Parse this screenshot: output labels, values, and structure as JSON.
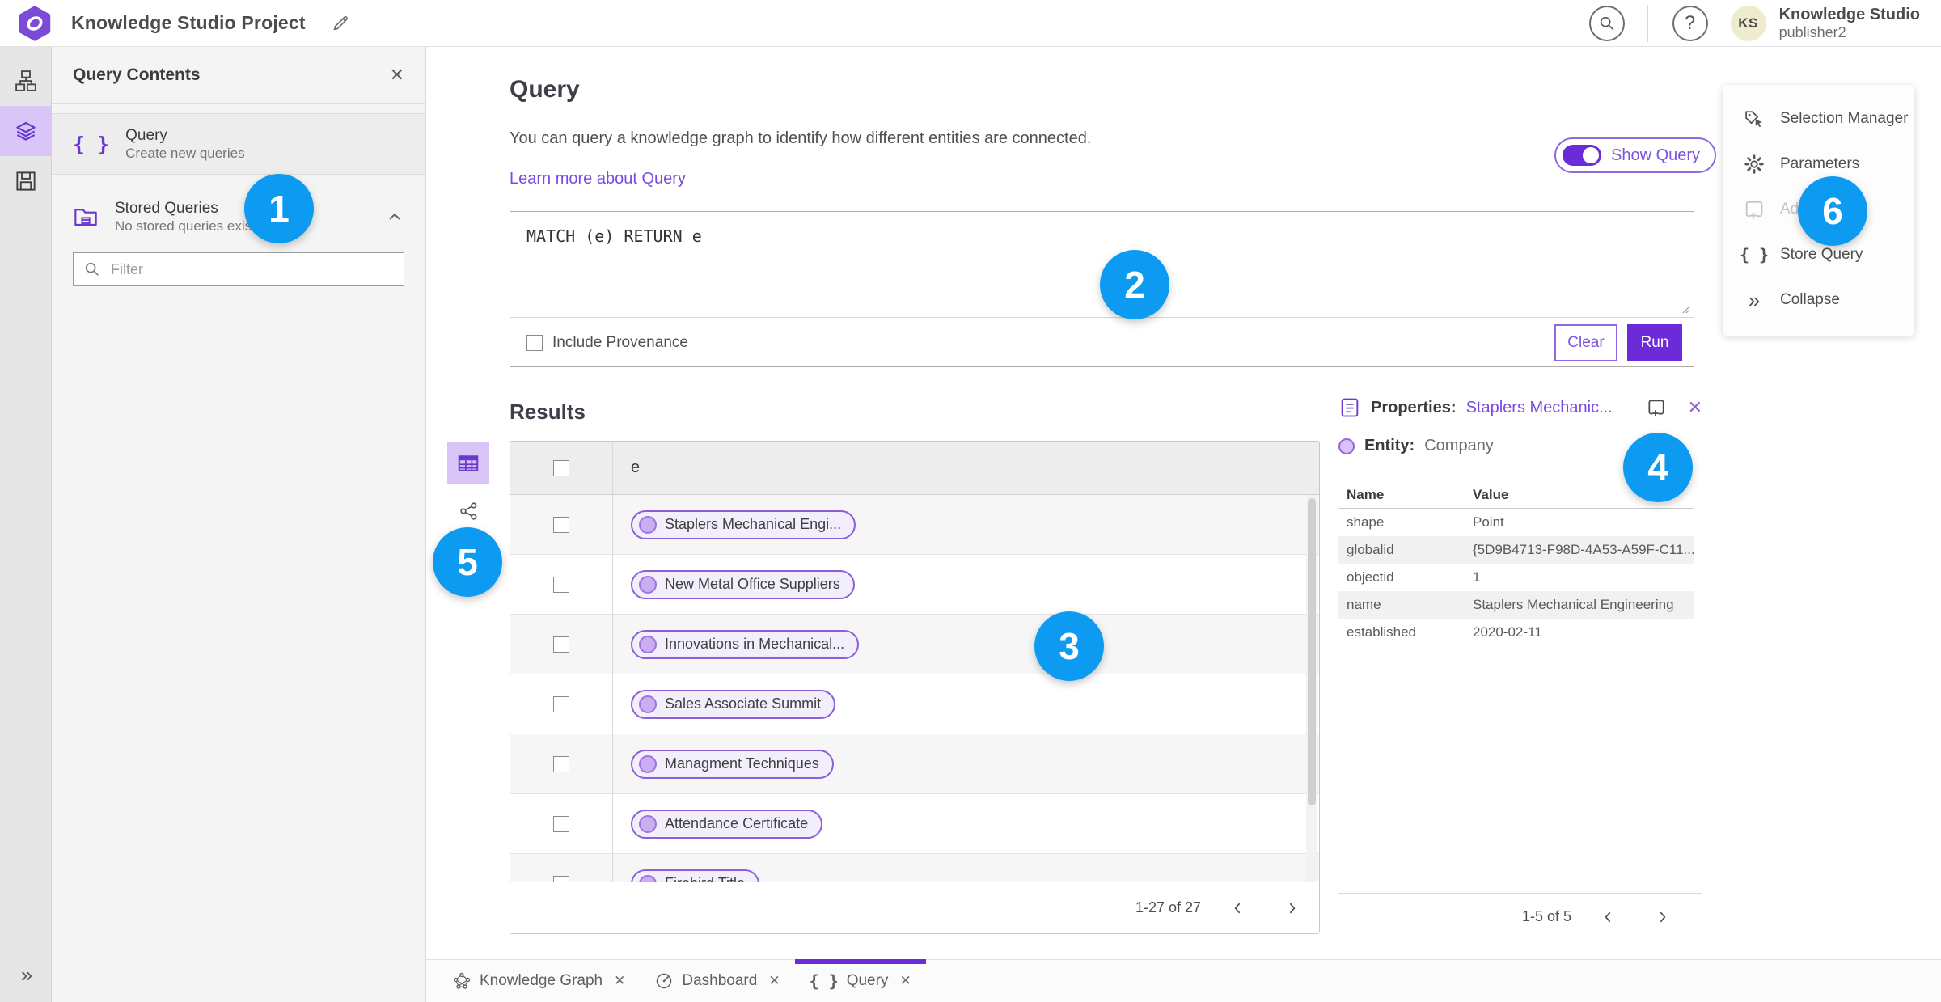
{
  "colors": {
    "accent_purple": "#6c2bd9",
    "link_purple": "#7a4be0",
    "selected_lavender": "#d9c5f7",
    "badge_blue": "#0d9bf2"
  },
  "header": {
    "title": "Knowledge Studio Project",
    "user_name": "Knowledge Studio",
    "user_sub": "publisher2",
    "avatar": "KS"
  },
  "query_contents": {
    "title": "Query Contents",
    "query_item": {
      "label": "Query",
      "sub": "Create new queries"
    },
    "stored_item": {
      "label": "Stored Queries",
      "sub": "No stored queries exist"
    },
    "filter_placeholder": "Filter"
  },
  "query": {
    "heading": "Query",
    "description": "You can query a knowledge graph to identify how different entities are connected.",
    "learn_link": "Learn more about Query",
    "show_query": "Show Query",
    "code": "MATCH (e) RETURN e",
    "include_provenance": "Include Provenance",
    "clear": "Clear",
    "run": "Run"
  },
  "results": {
    "heading": "Results",
    "column_e": "e",
    "rows": [
      "Staplers Mechanical Engi...",
      "New Metal Office Suppliers",
      "Innovations in Mechanical...",
      "Sales Associate Summit",
      "Managment Techniques",
      "Attendance Certificate",
      "Firebird Title"
    ],
    "pagination": "1-27 of 27"
  },
  "properties": {
    "label": "Properties:",
    "name": "Staplers Mechanic...",
    "entity_label": "Entity:",
    "entity_type": "Company",
    "col_name": "Name",
    "col_value": "Value",
    "rows": [
      {
        "name": "shape",
        "value": "Point"
      },
      {
        "name": "globalid",
        "value": "{5D9B4713-F98D-4A53-A59F-C11..."
      },
      {
        "name": "objectid",
        "value": "1"
      },
      {
        "name": "name",
        "value": "Staplers Mechanical Engineering"
      },
      {
        "name": "established",
        "value": "2020-02-11"
      }
    ],
    "pagination": "1-5 of 5"
  },
  "side_menu": {
    "items": [
      {
        "label": "Selection Manager"
      },
      {
        "label": "Parameters"
      },
      {
        "label": "Ad"
      },
      {
        "label": "Store Query"
      },
      {
        "label": "Collapse"
      }
    ]
  },
  "tabs": [
    {
      "label": "Knowledge Graph"
    },
    {
      "label": "Dashboard"
    },
    {
      "label": "Query"
    }
  ],
  "badges": [
    "1",
    "2",
    "3",
    "4",
    "5",
    "6"
  ]
}
